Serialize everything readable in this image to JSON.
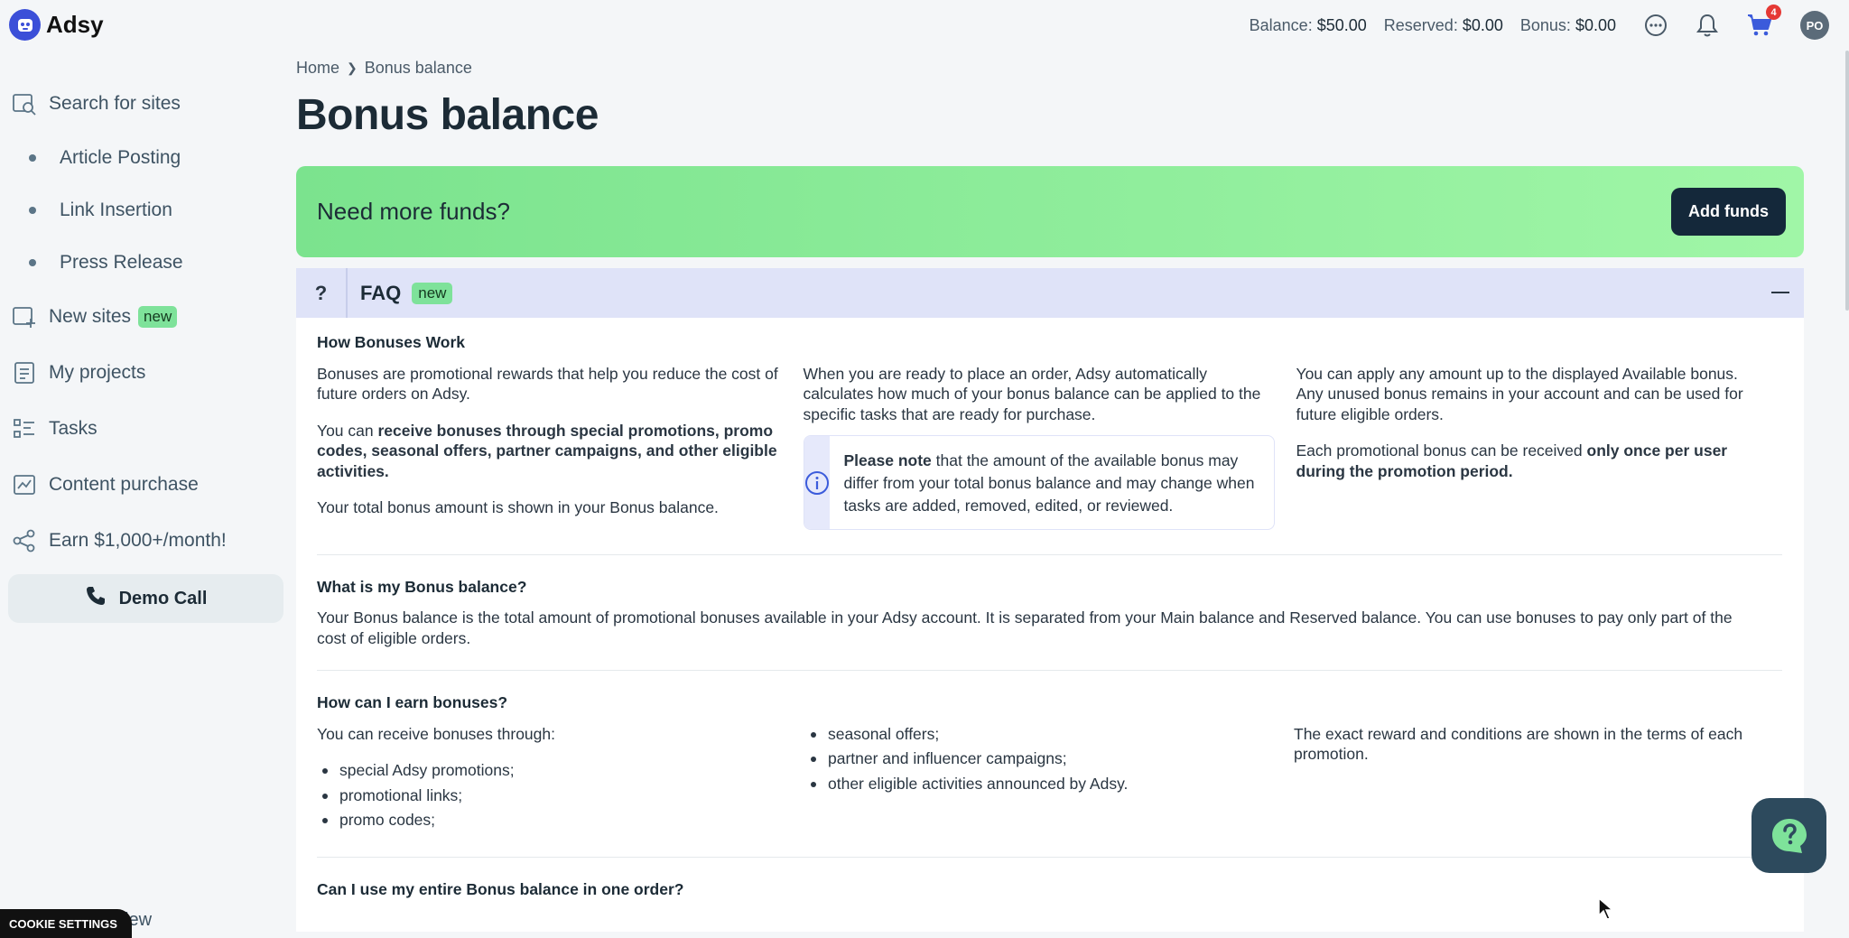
{
  "app": {
    "name": "Adsy"
  },
  "header": {
    "balance_label": "Balance:",
    "balance_value": "$50.00",
    "reserved_label": "Reserved:",
    "reserved_value": "$0.00",
    "bonus_label": "Bonus:",
    "bonus_value": "$0.00",
    "cart_count": "4",
    "avatar_initials": "PO"
  },
  "sidebar": {
    "items": [
      {
        "label": "Search for sites"
      },
      {
        "label": "Article Posting"
      },
      {
        "label": "Link Insertion"
      },
      {
        "label": "Press Release"
      },
      {
        "label": "New sites",
        "tag": "new"
      },
      {
        "label": "My projects"
      },
      {
        "label": "Tasks"
      },
      {
        "label": "Content purchase"
      },
      {
        "label": "Earn $1,000+/month!"
      }
    ],
    "demo_call": "Demo Call",
    "partial_item": "iew"
  },
  "cookie_settings": "COOKIE SETTINGS",
  "breadcrumb": {
    "home": "Home",
    "current": "Bonus balance"
  },
  "page_title": "Bonus balance",
  "funds_banner": {
    "text": "Need more funds?",
    "button": "Add funds"
  },
  "faq": {
    "icon": "?",
    "title": "FAQ",
    "tag": "new",
    "sections": {
      "how": {
        "title": "How Bonuses Work",
        "c1_p1": "Bonuses are promotional rewards that help you reduce the cost of future orders on Adsy.",
        "c1_p2_a": "You can ",
        "c1_p2_b": "receive bonuses through special promotions, promo codes, seasonal offers, partner campaigns, and other eligible activities.",
        "c1_p3": "Your total bonus amount is shown in your Bonus balance.",
        "c2_p1": "When you are ready to place an order, Adsy automatically calculates how much of your bonus balance can be applied to the specific tasks that are ready for purchase.",
        "note_bold": "Please note",
        "note_rest": " that the amount of the available bonus may differ from your total bonus balance and may change when tasks are added, removed, edited, or reviewed.",
        "c3_p1": "You can apply any amount up to the displayed Available bonus. Any unused bonus remains in your account and can be used for future eligible orders.",
        "c3_p2_a": "Each promotional bonus can be received ",
        "c3_p2_b": "only once per user during the promotion period."
      },
      "what": {
        "title": "What is my Bonus balance?",
        "text": "Your Bonus balance is the total amount of promotional bonuses available in your Adsy account. It is separated from your Main balance and Reserved balance. You can use bonuses to pay only part of the cost of eligible orders."
      },
      "earn": {
        "title": "How can I earn bonuses?",
        "intro": "You can receive bonuses through:",
        "list1": [
          "special Adsy promotions;",
          "promotional links;",
          "promo codes;"
        ],
        "list2": [
          "seasonal offers;",
          "partner and influencer campaigns;",
          "other eligible activities announced by Adsy."
        ],
        "outro": "The exact reward and conditions are shown in the terms of each promotion."
      },
      "entire": {
        "title": "Can I use my entire Bonus balance in one order?"
      }
    }
  }
}
